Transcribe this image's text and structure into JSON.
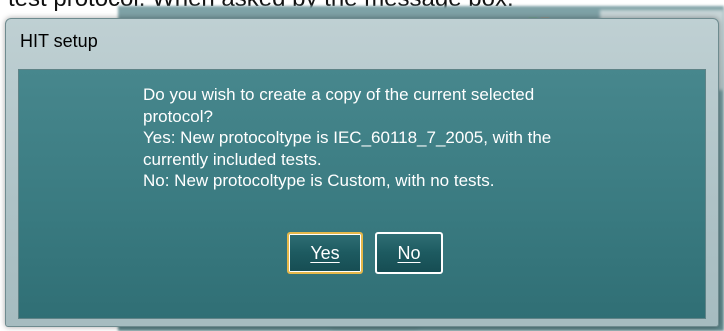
{
  "document": {
    "clipped_line": "test protocol. When asked by the message box:"
  },
  "dialog": {
    "title": "HIT setup",
    "message_lines": [
      "Do you wish to create a copy of the current selected",
      "protocol?",
      "Yes: New protocoltype is IEC_60118_7_2005, with the",
      "currently included tests.",
      "No: New protocoltype is Custom, with no tests."
    ],
    "buttons": {
      "yes_label": "Yes",
      "no_label": "No"
    }
  },
  "colors": {
    "dialog_body": "#3a7b81",
    "button": "#1d5a60",
    "default_button_border": "#e6b84a"
  }
}
